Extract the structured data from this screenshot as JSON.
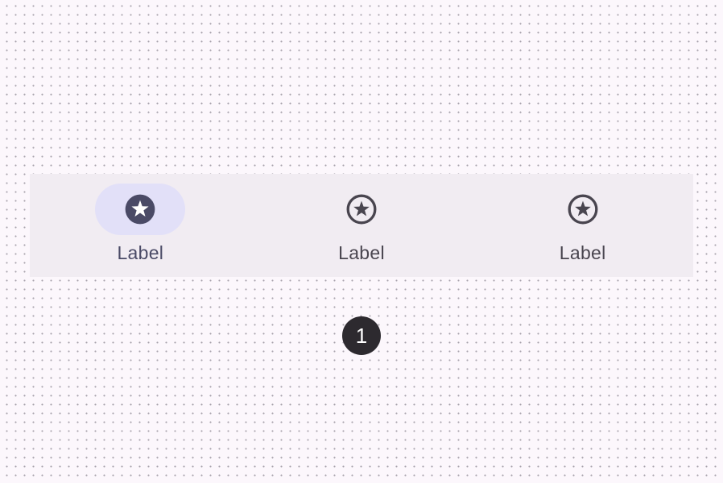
{
  "navigation_bar": {
    "items": [
      {
        "label": "Label",
        "icon": "star-circle-filled-icon",
        "selected": true
      },
      {
        "label": "Label",
        "icon": "star-circle-outline-icon",
        "selected": false
      },
      {
        "label": "Label",
        "icon": "star-circle-outline-icon",
        "selected": false
      }
    ]
  },
  "step_badge": {
    "number": "1"
  },
  "colors": {
    "background": "#fcf7fc",
    "nav_bar": "#f1ecf2",
    "active_indicator": "#e2e0f8",
    "icon_active": "#4a4a66",
    "icon_inactive": "#49454f",
    "badge": "#2d2a2f"
  }
}
